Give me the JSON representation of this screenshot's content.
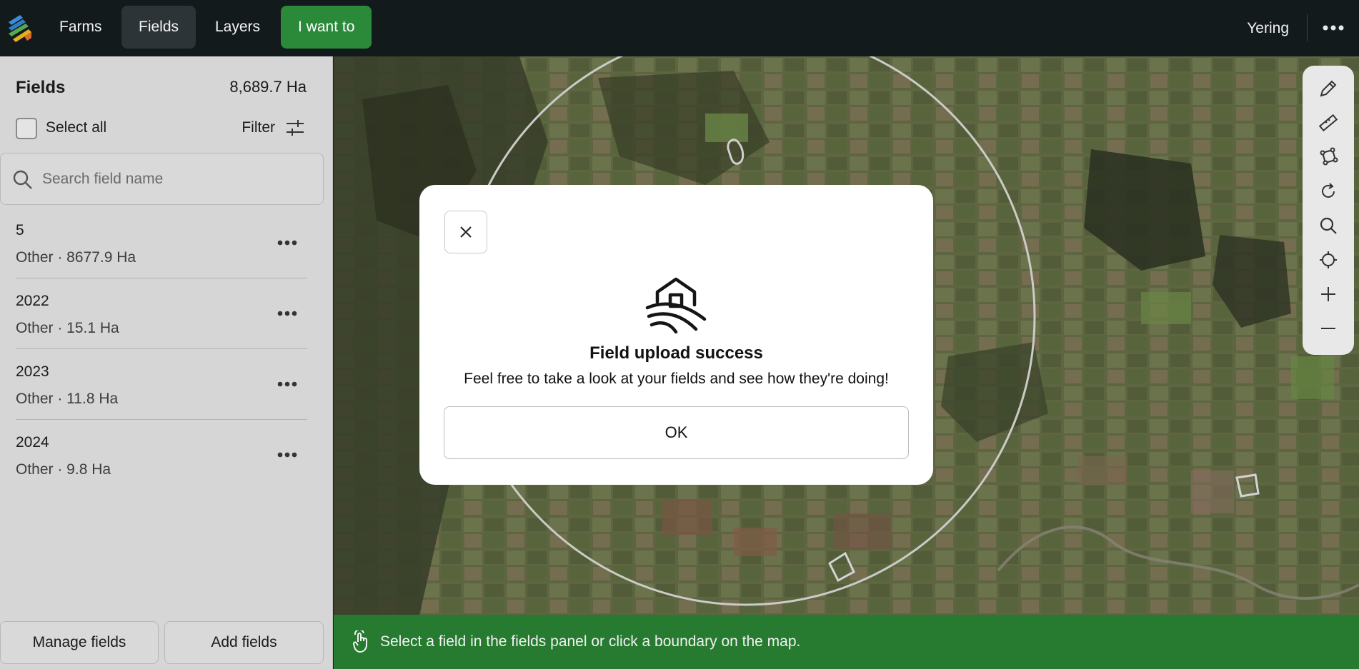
{
  "topbar": {
    "nav": [
      "Farms",
      "Fields",
      "Layers"
    ],
    "primary_label": "I want to",
    "farm_name": "Yering"
  },
  "sidebar": {
    "title": "Fields",
    "total_area": "8,689.7 Ha",
    "select_all_label": "Select all",
    "filter_label": "Filter",
    "search_placeholder": "Search field name",
    "fields": [
      {
        "name": "5",
        "meta": "Other · 8677.9 Ha"
      },
      {
        "name": "2022",
        "meta": "Other · 15.1 Ha"
      },
      {
        "name": "2023",
        "meta": "Other · 11.8 Ha"
      },
      {
        "name": "2024",
        "meta": "Other · 9.8 Ha"
      }
    ],
    "manage_label": "Manage fields",
    "add_label": "Add fields"
  },
  "map": {
    "tools": [
      "pencil-icon",
      "ruler-icon",
      "polygon-icon",
      "redo-icon",
      "search-icon",
      "locate-icon",
      "zoom-in-icon",
      "zoom-out-icon"
    ],
    "status_text": "Select a field in the fields panel or click a boundary on the map."
  },
  "modal": {
    "title": "Field upload success",
    "message": "Feel free to take a look at your fields and see how they're doing!",
    "ok_label": "OK"
  },
  "colors": {
    "topbar_bg": "#121a1c",
    "primary_green": "#2a8a3a",
    "status_green": "#267b31",
    "sidebar_bg": "#d6d6d6"
  }
}
